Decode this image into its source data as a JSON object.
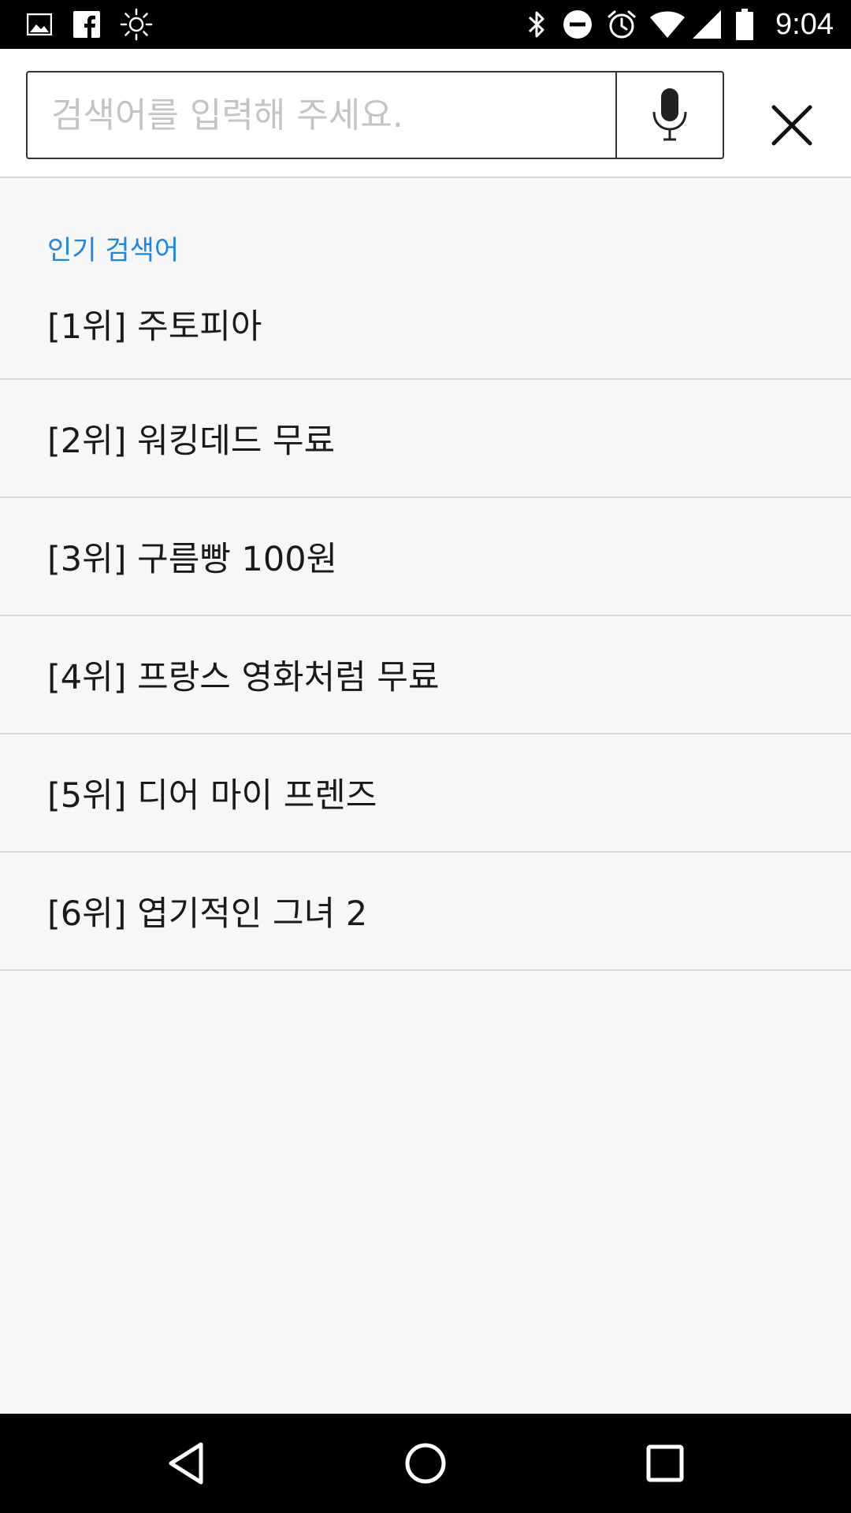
{
  "status_bar": {
    "time": "9:04",
    "left_icons": [
      "image-icon",
      "facebook-icon",
      "brightness-icon"
    ],
    "right_icons": [
      "bluetooth-icon",
      "do-not-disturb-icon",
      "alarm-icon",
      "wifi-icon",
      "signal-icon",
      "battery-icon"
    ]
  },
  "search": {
    "placeholder": "검색어를 입력해 주세요.",
    "value": ""
  },
  "popular": {
    "label": "인기 검색어",
    "items": [
      "[1위] 주토피아",
      "[2위] 워킹데드 무료",
      "[3위] 구름빵 100원",
      "[4위] 프랑스 영화처럼 무료",
      "[5위] 디어 마이 프렌즈",
      "[6위] 엽기적인 그녀 2"
    ]
  },
  "colors": {
    "accent": "#1a86e8",
    "background": "#f7f7f7",
    "divider": "#d9d9d9"
  }
}
